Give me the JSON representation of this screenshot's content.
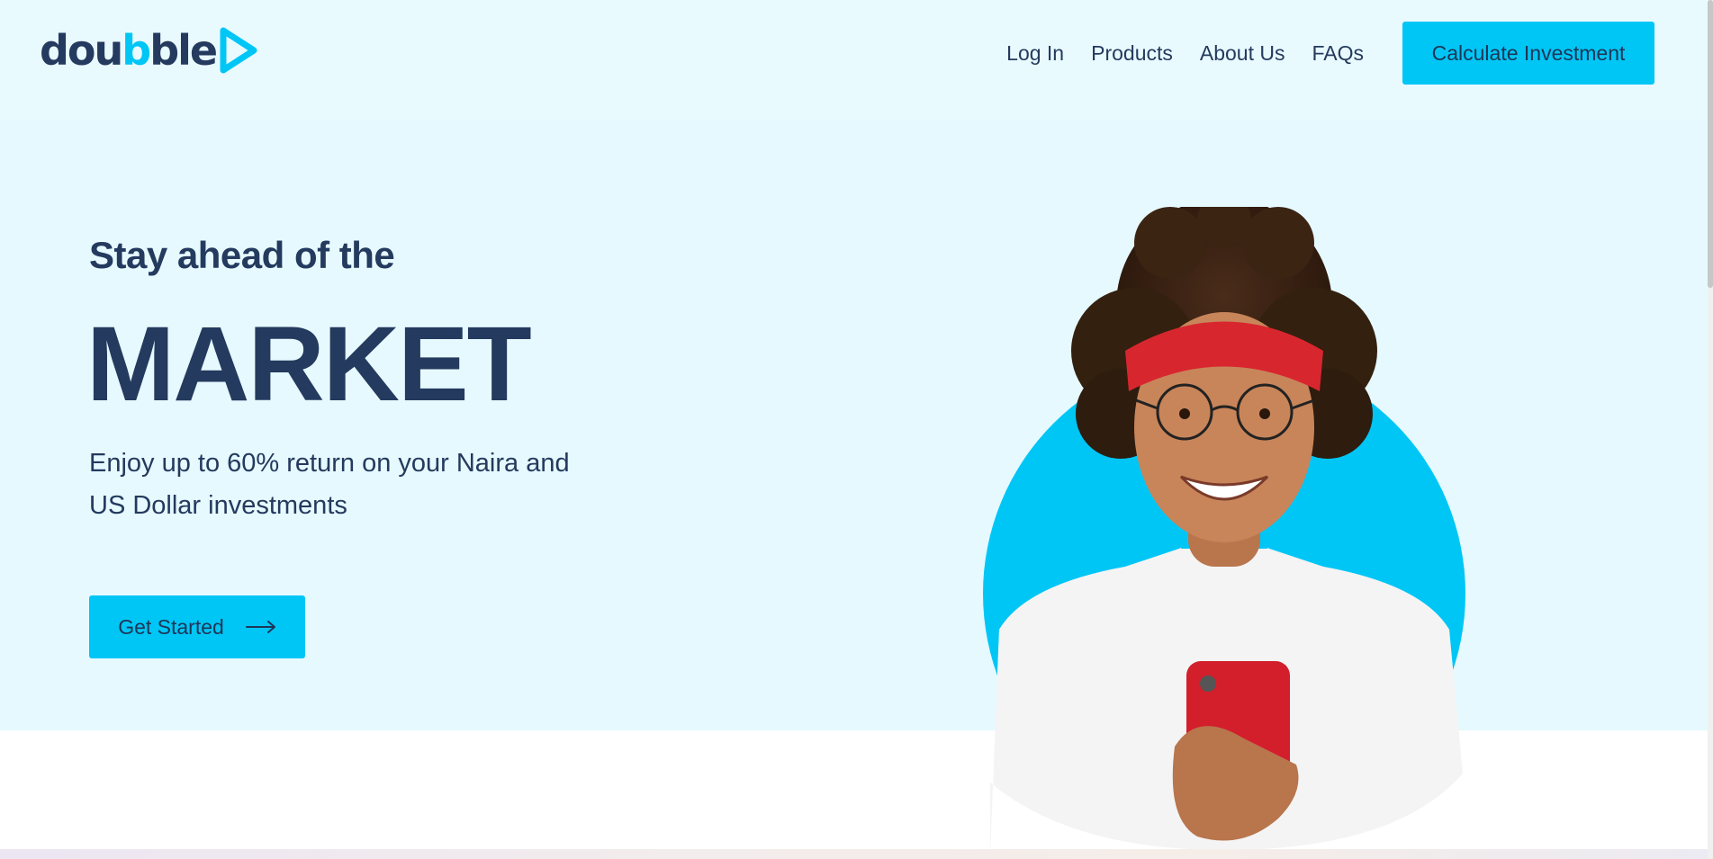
{
  "logo": {
    "text_pre": "dou",
    "text_accent": "b",
    "text_post": "ble",
    "icon": "play-icon"
  },
  "nav": {
    "links": [
      {
        "label": "Log In"
      },
      {
        "label": "Products"
      },
      {
        "label": "About Us"
      },
      {
        "label": "FAQs"
      }
    ],
    "cta_label": "Calculate Investment"
  },
  "hero": {
    "pre_title": "Stay ahead of the",
    "title": "MARKET",
    "subtitle": "Enjoy up to 60% return on your Naira and US Dollar investments",
    "button_label": "Get Started",
    "button_icon": "arrow-right-icon",
    "image": "woman-smiling-at-phone-illustration"
  },
  "colors": {
    "accent": "#00c6f6",
    "navy": "#243a5e",
    "hero_bg": "#e6f9fe",
    "headband": "#d8262f"
  }
}
